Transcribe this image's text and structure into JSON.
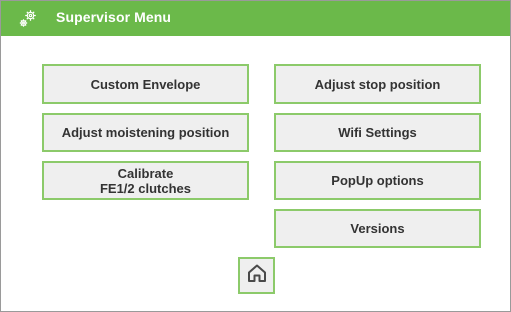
{
  "header": {
    "title": "Supervisor Menu",
    "icon": "gears-icon",
    "color": "#6bb94a"
  },
  "menu": {
    "custom_envelope": "Custom Envelope",
    "adjust_stop_position": "Adjust stop position",
    "adjust_moistening_position": "Adjust moistening position",
    "wifi_settings": "Wifi Settings",
    "calibrate_clutches": "Calibrate\nFE1/2 clutches",
    "popup_options": "PopUp options",
    "versions": "Versions"
  },
  "footer": {
    "home_icon": "home-icon"
  },
  "colors": {
    "button_border": "#8cca6a",
    "button_background": "#efefef",
    "button_text": "#333333"
  }
}
